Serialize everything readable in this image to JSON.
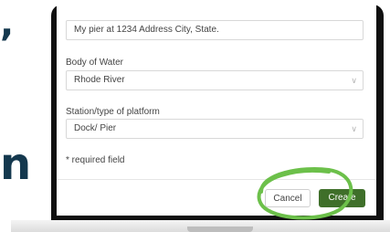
{
  "form": {
    "location_value": "My pier at 1234 Address City, State.",
    "body_of_water": {
      "label": "Body of Water",
      "selected": "Rhode River"
    },
    "station_type": {
      "label": "Station/type of platform",
      "selected": "Dock/ Pier"
    },
    "required_note": "* required field"
  },
  "footer": {
    "cancel_label": "Cancel",
    "create_label": "Create"
  },
  "background_text": {
    "comma": ",",
    "letter": "n"
  },
  "colors": {
    "brand_dark": "#14384e",
    "create_button": "#3f6f2a",
    "highlight_ring": "#6cc04a"
  },
  "icons": {
    "dropdown": "chevron-down-icon"
  }
}
